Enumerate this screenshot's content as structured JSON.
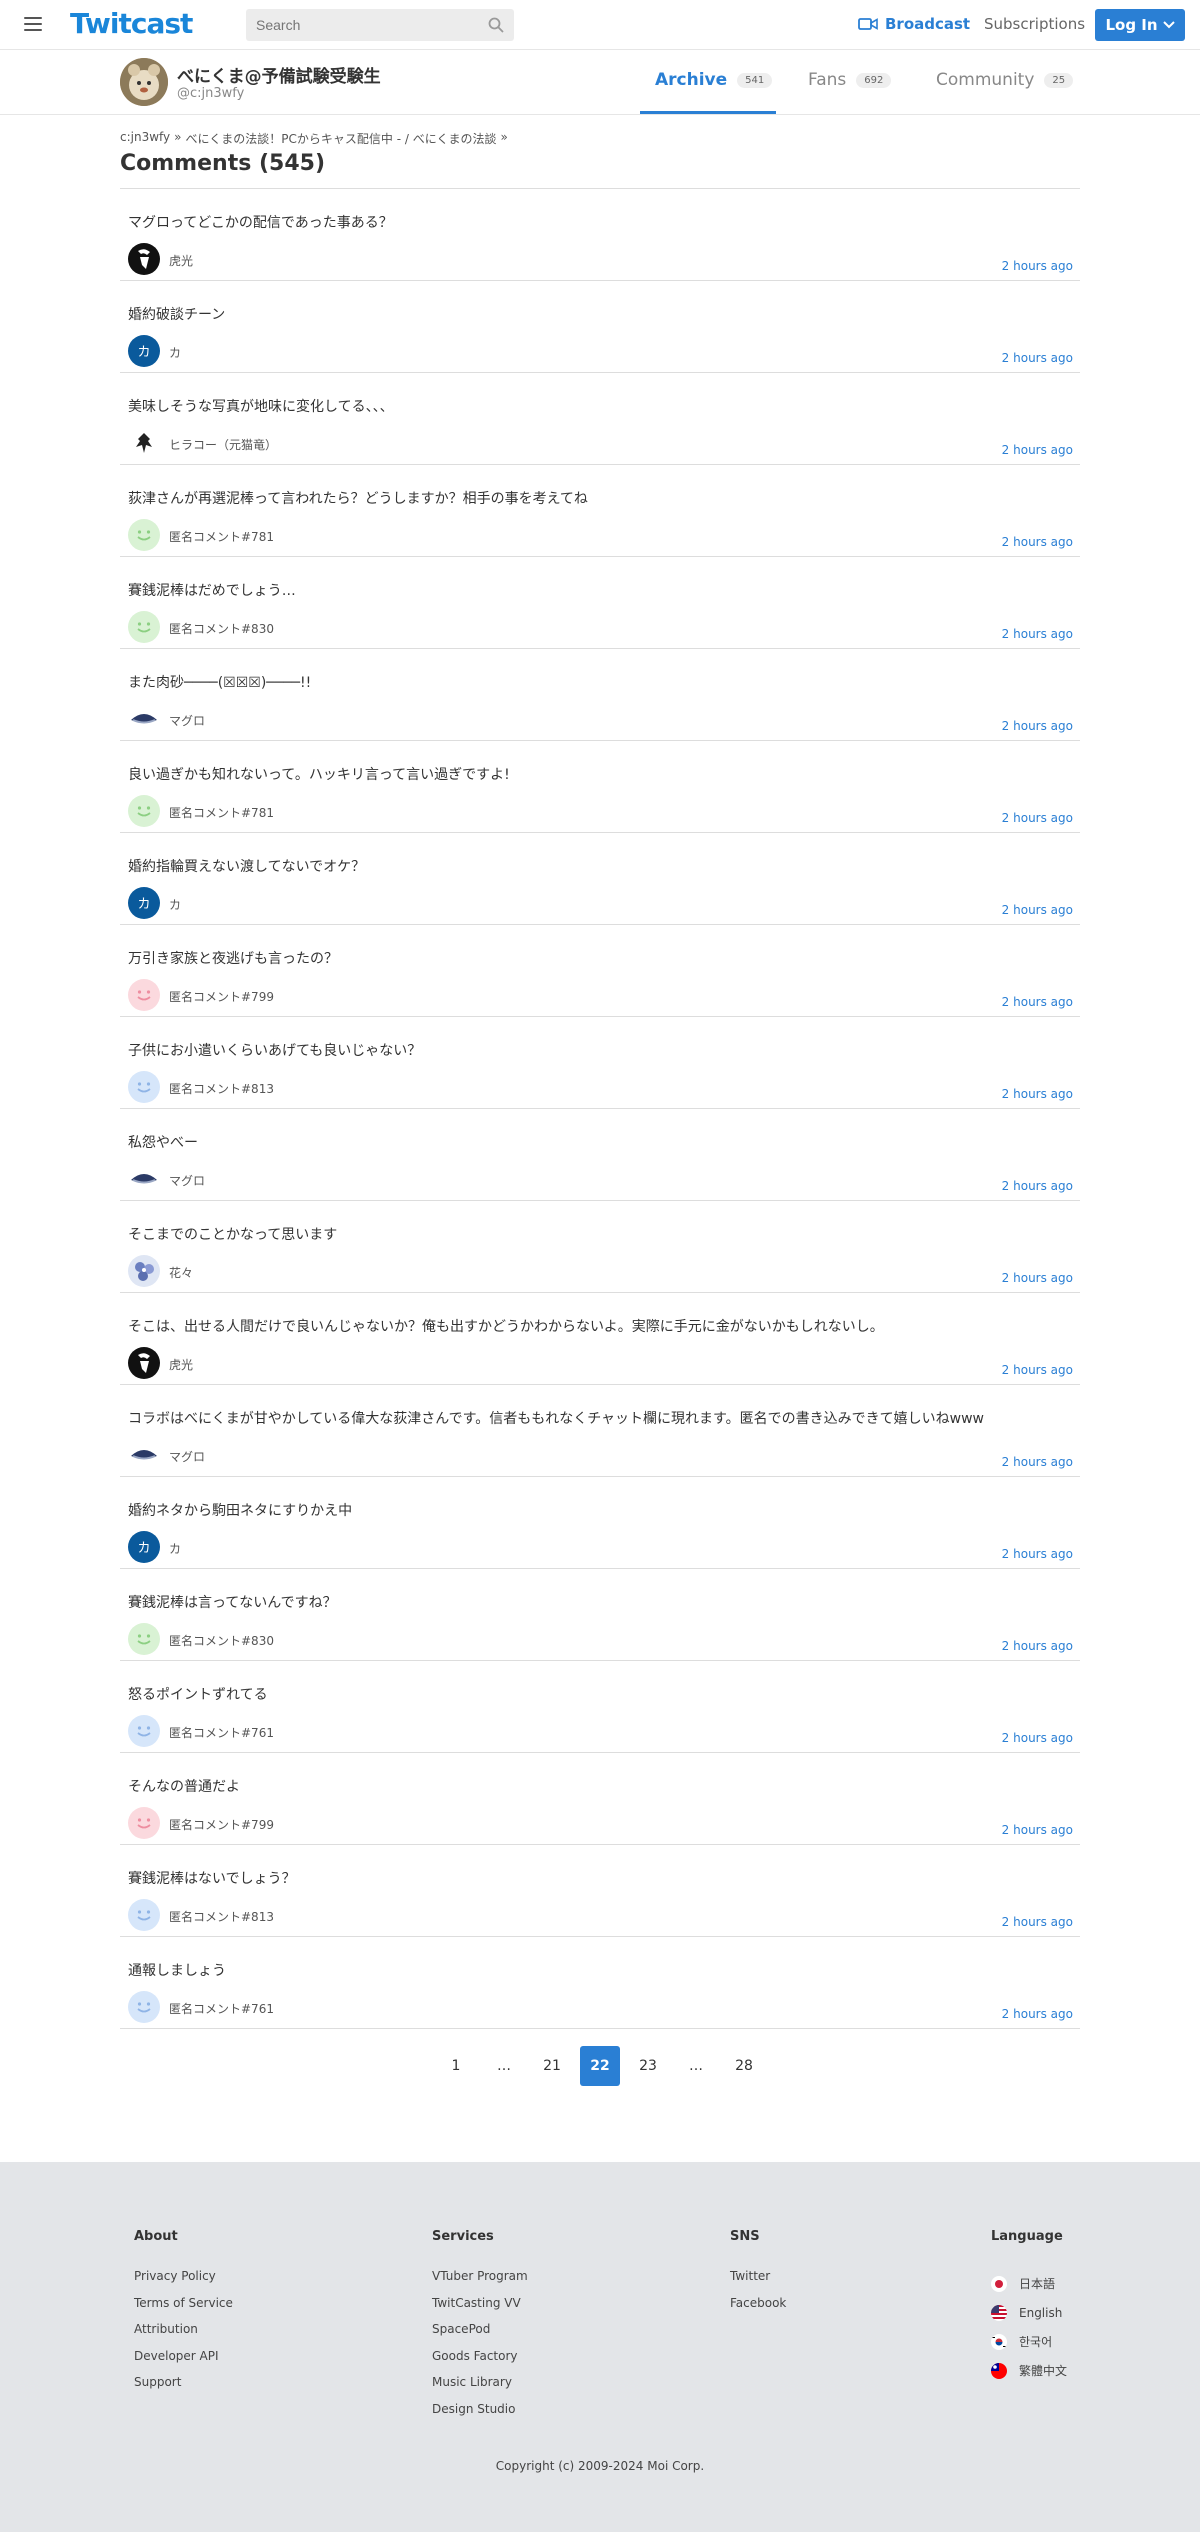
{
  "nav": {
    "logo": "Twitcast",
    "search_placeholder": "Search",
    "broadcast_label": "Broadcast",
    "subscriptions_label": "Subscriptions",
    "login_label": "Log In"
  },
  "profile": {
    "name": "べにくま@予備試験受験生",
    "handle": "@c:jn3wfy",
    "tabs": [
      {
        "label": "Archive",
        "count": "541"
      },
      {
        "label": "Fans",
        "count": "692"
      },
      {
        "label": "Community",
        "count": "25"
      }
    ]
  },
  "breadcrumb": {
    "item1": "c:jn3wfy",
    "sep": "»",
    "item2": "べにくまの法談！PCからキャス配信中 - / べにくまの法談"
  },
  "page_title": "Comments (545)",
  "comments": [
    {
      "text": "マグロってどこかの配信であった事ある？",
      "user": "虎光",
      "time": "2 hours ago",
      "avatar": "tora"
    },
    {
      "text": "婚約破談チーン",
      "user": "カ",
      "time": "2 hours ago",
      "avatar": "ka"
    },
    {
      "text": "美味しそうな写真が地味に変化してる、、、",
      "user": "ヒラコー（元猫竜）",
      "time": "2 hours ago",
      "avatar": "hira"
    },
    {
      "text": "荻津さんが再選泥棒って言われたら？どうしますか？相手の事を考えてね",
      "user": "匿名コメント#781",
      "time": "2 hours ago",
      "avatar": "anon-green"
    },
    {
      "text": "賽銭泥棒はだめでしょう…",
      "user": "匿名コメント#830",
      "time": "2 hours ago",
      "avatar": "anon-green"
    },
    {
      "text": "また肉砂────(☒☒☒)────!!",
      "user": "マグロ",
      "time": "2 hours ago",
      "avatar": "maguro"
    },
    {
      "text": "良い過ぎかも知れないって。ハッキリ言って言い過ぎですよ!",
      "user": "匿名コメント#781",
      "time": "2 hours ago",
      "avatar": "anon-green"
    },
    {
      "text": "婚約指輪買えない渡してないでオケ？",
      "user": "カ",
      "time": "2 hours ago",
      "avatar": "ka"
    },
    {
      "text": "万引き家族と夜逃げも言ったの？",
      "user": "匿名コメント#799",
      "time": "2 hours ago",
      "avatar": "anon-pink"
    },
    {
      "text": "子供にお小遣いくらいあげても良いじゃない？",
      "user": "匿名コメント#813",
      "time": "2 hours ago",
      "avatar": "anon-blue"
    },
    {
      "text": "私怨やべー",
      "user": "マグロ",
      "time": "2 hours ago",
      "avatar": "maguro"
    },
    {
      "text": "そこまでのことかなって思います",
      "user": "花々",
      "time": "2 hours ago",
      "avatar": "hana"
    },
    {
      "text": "そこは、出せる人間だけで良いんじゃないか？俺も出すかどうかわからないよ。実際に手元に金がないかもしれないし。",
      "user": "虎光",
      "time": "2 hours ago",
      "avatar": "tora"
    },
    {
      "text": "コラボはべにくまが甘やかしている偉大な荻津さんです。信者ももれなくチャット欄に現れます。匿名での書き込みできて嬉しいねwww",
      "user": "マグロ",
      "time": "2 hours ago",
      "avatar": "maguro"
    },
    {
      "text": "婚約ネタから駒田ネタにすりかえ中",
      "user": "カ",
      "time": "2 hours ago",
      "avatar": "ka"
    },
    {
      "text": "賽銭泥棒は言ってないんですね？",
      "user": "匿名コメント#830",
      "time": "2 hours ago",
      "avatar": "anon-green"
    },
    {
      "text": "怒るポイントずれてる",
      "user": "匿名コメント#761",
      "time": "2 hours ago",
      "avatar": "anon-blue"
    },
    {
      "text": "そんなの普通だよ",
      "user": "匿名コメント#799",
      "time": "2 hours ago",
      "avatar": "anon-pink"
    },
    {
      "text": "賽銭泥棒はないでしょう？",
      "user": "匿名コメント#813",
      "time": "2 hours ago",
      "avatar": "anon-blue"
    },
    {
      "text": "通報しましょう",
      "user": "匿名コメント#761",
      "time": "2 hours ago",
      "avatar": "anon-blue"
    }
  ],
  "pagination": {
    "pages": [
      "1",
      "…",
      "21",
      "22",
      "23",
      "…",
      "28"
    ],
    "current": "22"
  },
  "footer": {
    "about": {
      "title": "About",
      "links": [
        "Privacy Policy",
        "Terms of Service",
        "Attribution",
        "Developer API",
        "Support"
      ]
    },
    "services": {
      "title": "Services",
      "links": [
        "VTuber Program",
        "TwitCasting VV",
        "SpacePod",
        "Goods Factory",
        "Music Library",
        "Design Studio"
      ]
    },
    "sns": {
      "title": "SNS",
      "links": [
        "Twitter",
        "Facebook"
      ]
    },
    "language": {
      "title": "Language",
      "items": [
        {
          "label": "日本語",
          "flag": "jp-flag-icon"
        },
        {
          "label": "English",
          "flag": "us-flag-icon"
        },
        {
          "label": "한국어",
          "flag": "kr-flag-icon"
        },
        {
          "label": "繁體中文",
          "flag": "tw-flag-icon"
        }
      ]
    },
    "copyright": "Copyright (c) 2009-2024 Moi Corp."
  },
  "colors": {
    "accent": "#2a7fd4",
    "footer_bg": "#e3e5e8"
  }
}
